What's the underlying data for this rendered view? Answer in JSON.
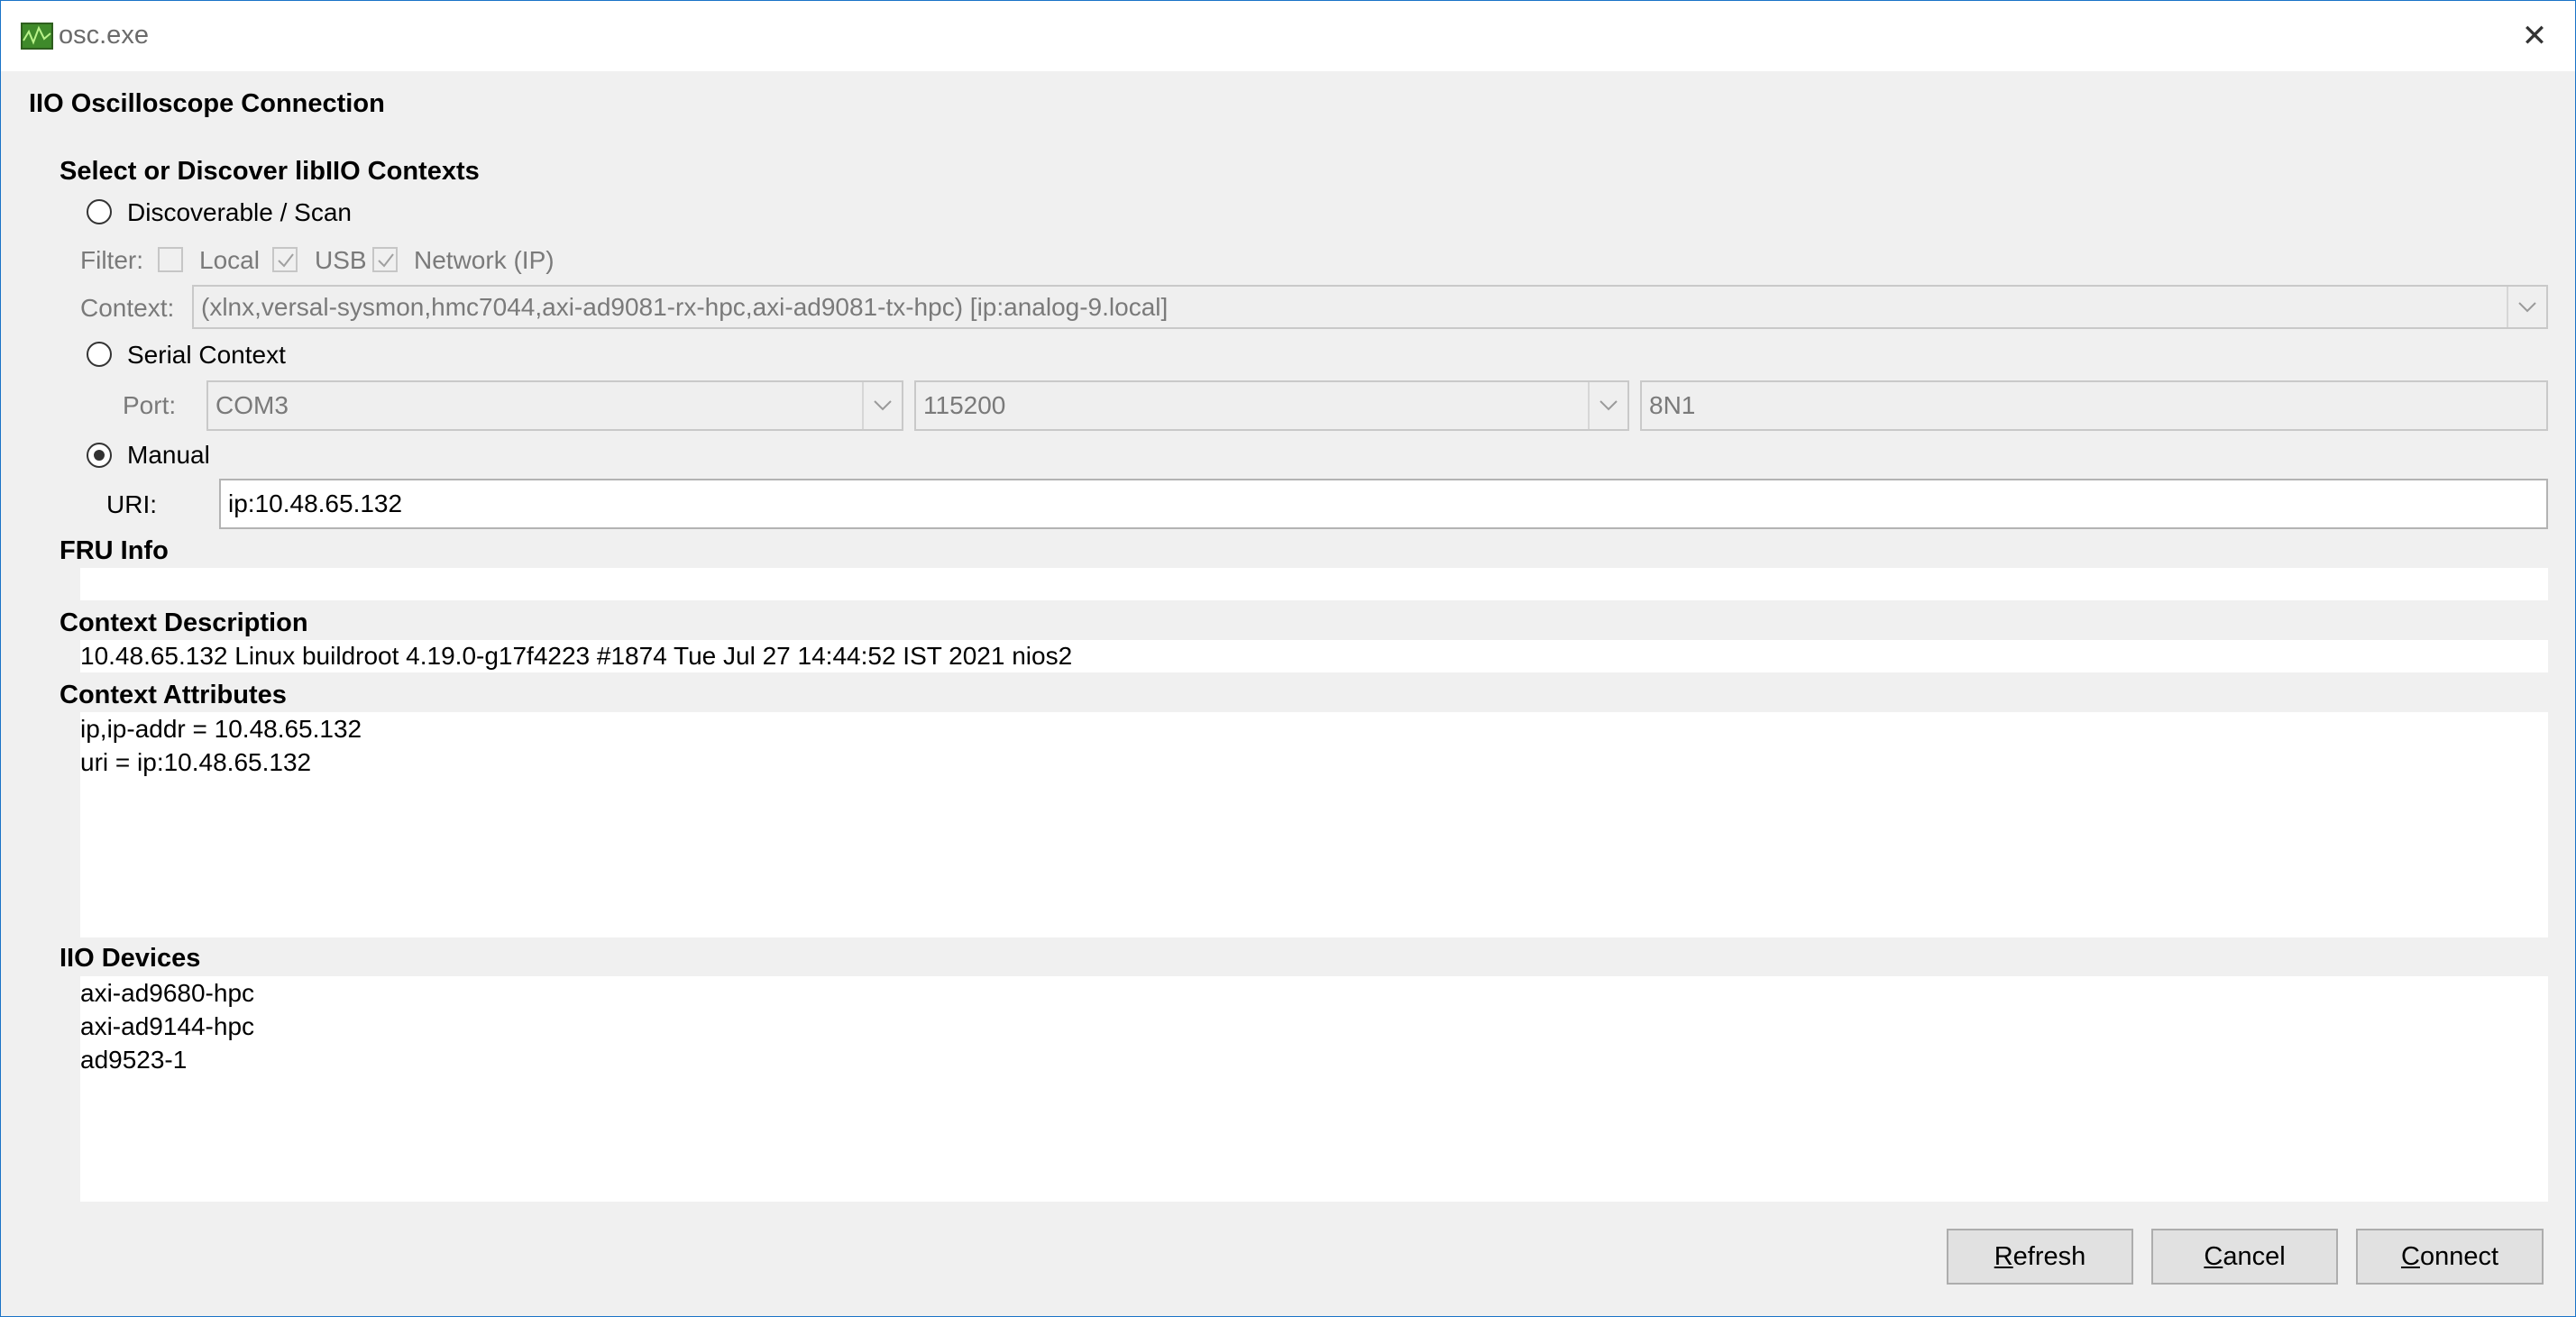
{
  "window": {
    "title": "osc.exe",
    "close_label": "✕"
  },
  "dialog": {
    "heading": "IIO Oscilloscope Connection",
    "section_title": "Select or Discover libIIO Contexts"
  },
  "discoverable": {
    "radio_label": "Discoverable / Scan",
    "selected": false,
    "filter_label": "Filter:",
    "filters": [
      {
        "label": "Local",
        "checked": false
      },
      {
        "label": "USB",
        "checked": true
      },
      {
        "label": "Network (IP)",
        "checked": true
      }
    ],
    "context_label": "Context:",
    "context_value": "(xlnx,versal-sysmon,hmc7044,axi-ad9081-rx-hpc,axi-ad9081-tx-hpc) [ip:analog-9.local]"
  },
  "serial": {
    "radio_label": "Serial Context",
    "selected": false,
    "port_label": "Port:",
    "port_value": "COM3",
    "baud_value": "115200",
    "format_value": "8N1"
  },
  "manual": {
    "radio_label": "Manual",
    "selected": true,
    "uri_label": "URI:",
    "uri_value": "ip:10.48.65.132"
  },
  "fru": {
    "title": "FRU Info",
    "value": ""
  },
  "context_description": {
    "title": "Context Description",
    "value": "10.48.65.132 Linux buildroot 4.19.0-g17f4223 #1874 Tue Jul 27 14:44:52 IST 2021 nios2"
  },
  "context_attributes": {
    "title": "Context Attributes",
    "lines": [
      "ip,ip-addr = 10.48.65.132",
      "uri = ip:10.48.65.132"
    ]
  },
  "iio_devices": {
    "title": "IIO Devices",
    "lines": [
      "axi-ad9680-hpc",
      "axi-ad9144-hpc",
      "ad9523-1"
    ]
  },
  "buttons": {
    "refresh": {
      "accel": "R",
      "rest": "efresh"
    },
    "cancel": {
      "accel": "C",
      "rest": "ancel"
    },
    "connect": {
      "accel": "C",
      "rest": "onnect"
    }
  },
  "colors": {
    "window_bg": "#f0f0f0",
    "border_accent": "#1a73c7",
    "disabled_text": "#7a7a7a"
  },
  "icons": [
    "app-icon",
    "close-icon",
    "checkmark-icon",
    "chevron-down-icon"
  ]
}
